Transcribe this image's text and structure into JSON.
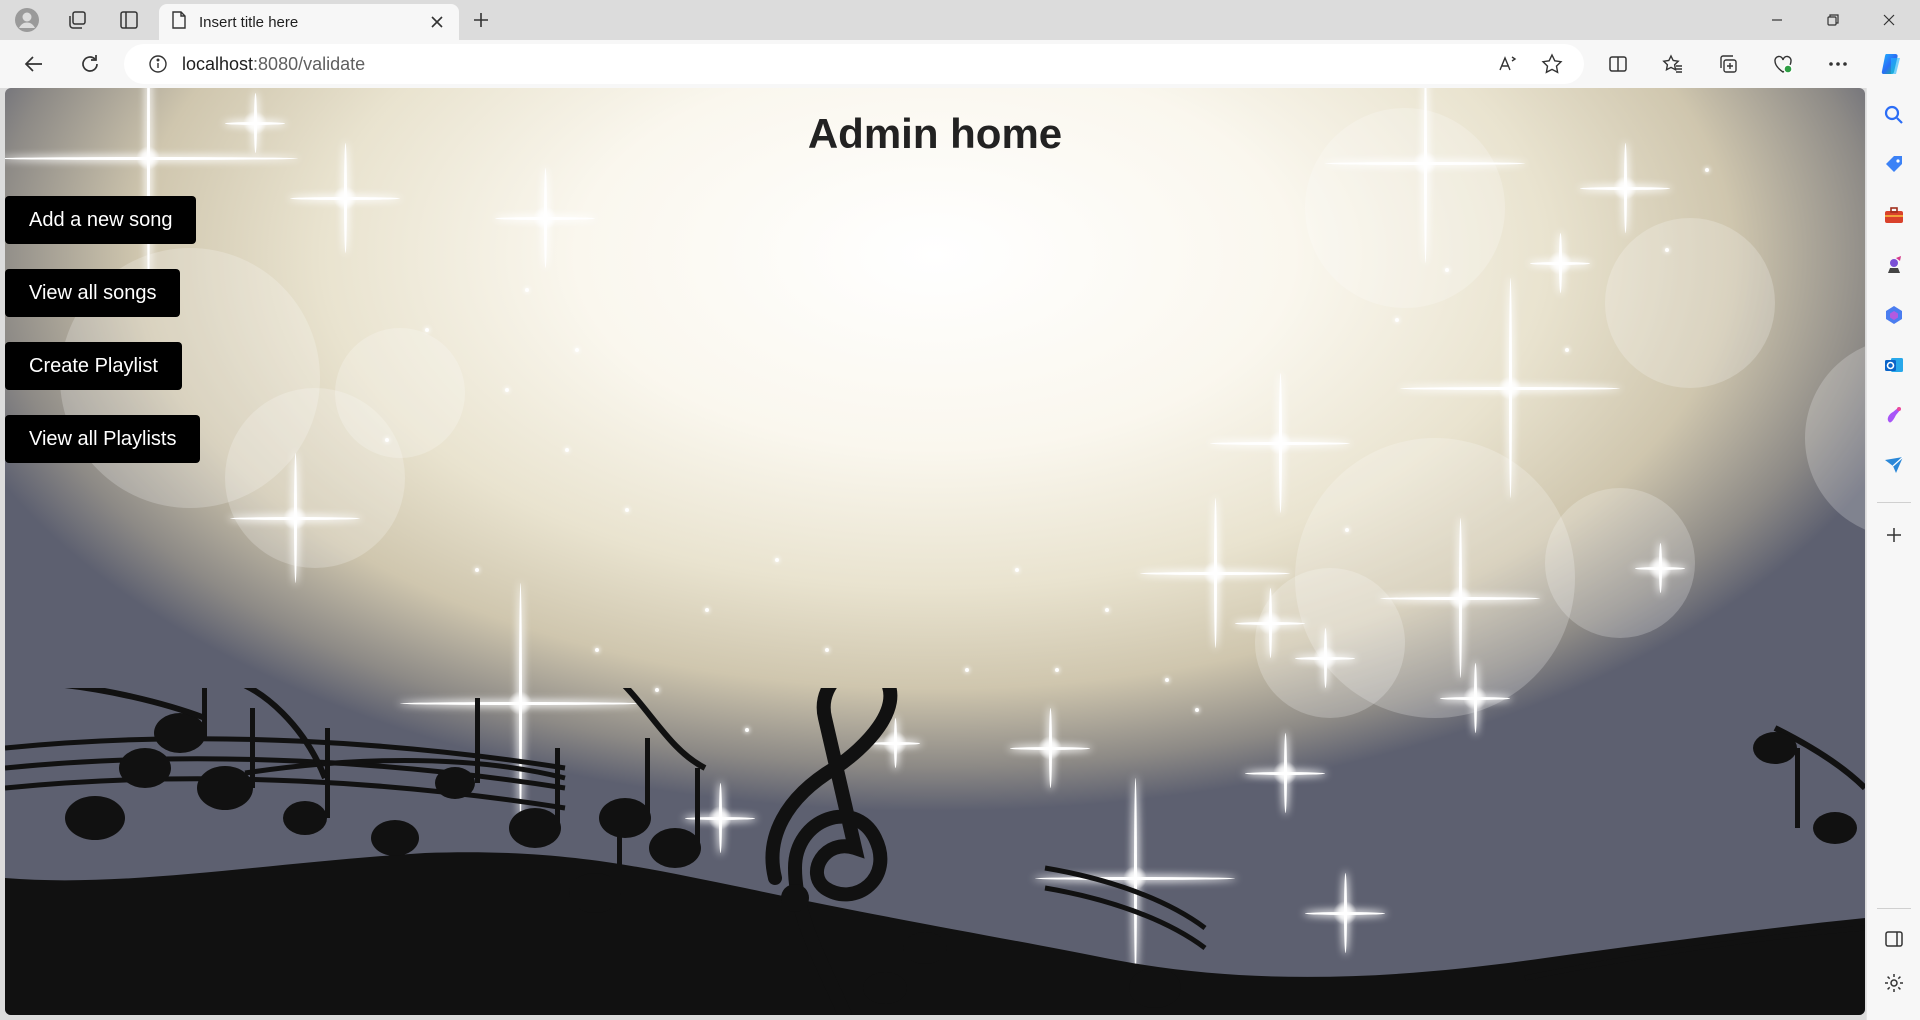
{
  "browser": {
    "tab": {
      "title": "Insert title here"
    },
    "address": {
      "host": "localhost",
      "path": ":8080/validate"
    }
  },
  "page": {
    "title": "Admin home",
    "buttons": [
      {
        "label": "Add a new song"
      },
      {
        "label": "View all songs"
      },
      {
        "label": "Create Playlist"
      },
      {
        "label": "View all Playlists"
      }
    ]
  },
  "colors": {
    "button_bg": "#000000",
    "button_text": "#ffffff",
    "title_text": "#222222"
  },
  "icons": {
    "tabstrip": [
      "profile-icon",
      "workspaces-icon",
      "tab-actions-icon",
      "page-icon",
      "close-icon",
      "new-tab-icon"
    ],
    "window": [
      "minimize-icon",
      "restore-icon",
      "close-window-icon"
    ],
    "toolbar": [
      "back-icon",
      "refresh-icon",
      "info-icon",
      "read-aloud-icon",
      "favorite-star-icon",
      "split-screen-icon",
      "favorites-icon",
      "collections-icon",
      "browser-essentials-icon",
      "more-icon",
      "copilot-icon"
    ],
    "sidebar": [
      "search-icon",
      "shopping-icon",
      "tools-icon",
      "games-icon",
      "microsoft365-icon",
      "outlook-icon",
      "designer-icon",
      "send-icon",
      "add-icon",
      "hide-sidebar-icon",
      "settings-icon"
    ]
  }
}
